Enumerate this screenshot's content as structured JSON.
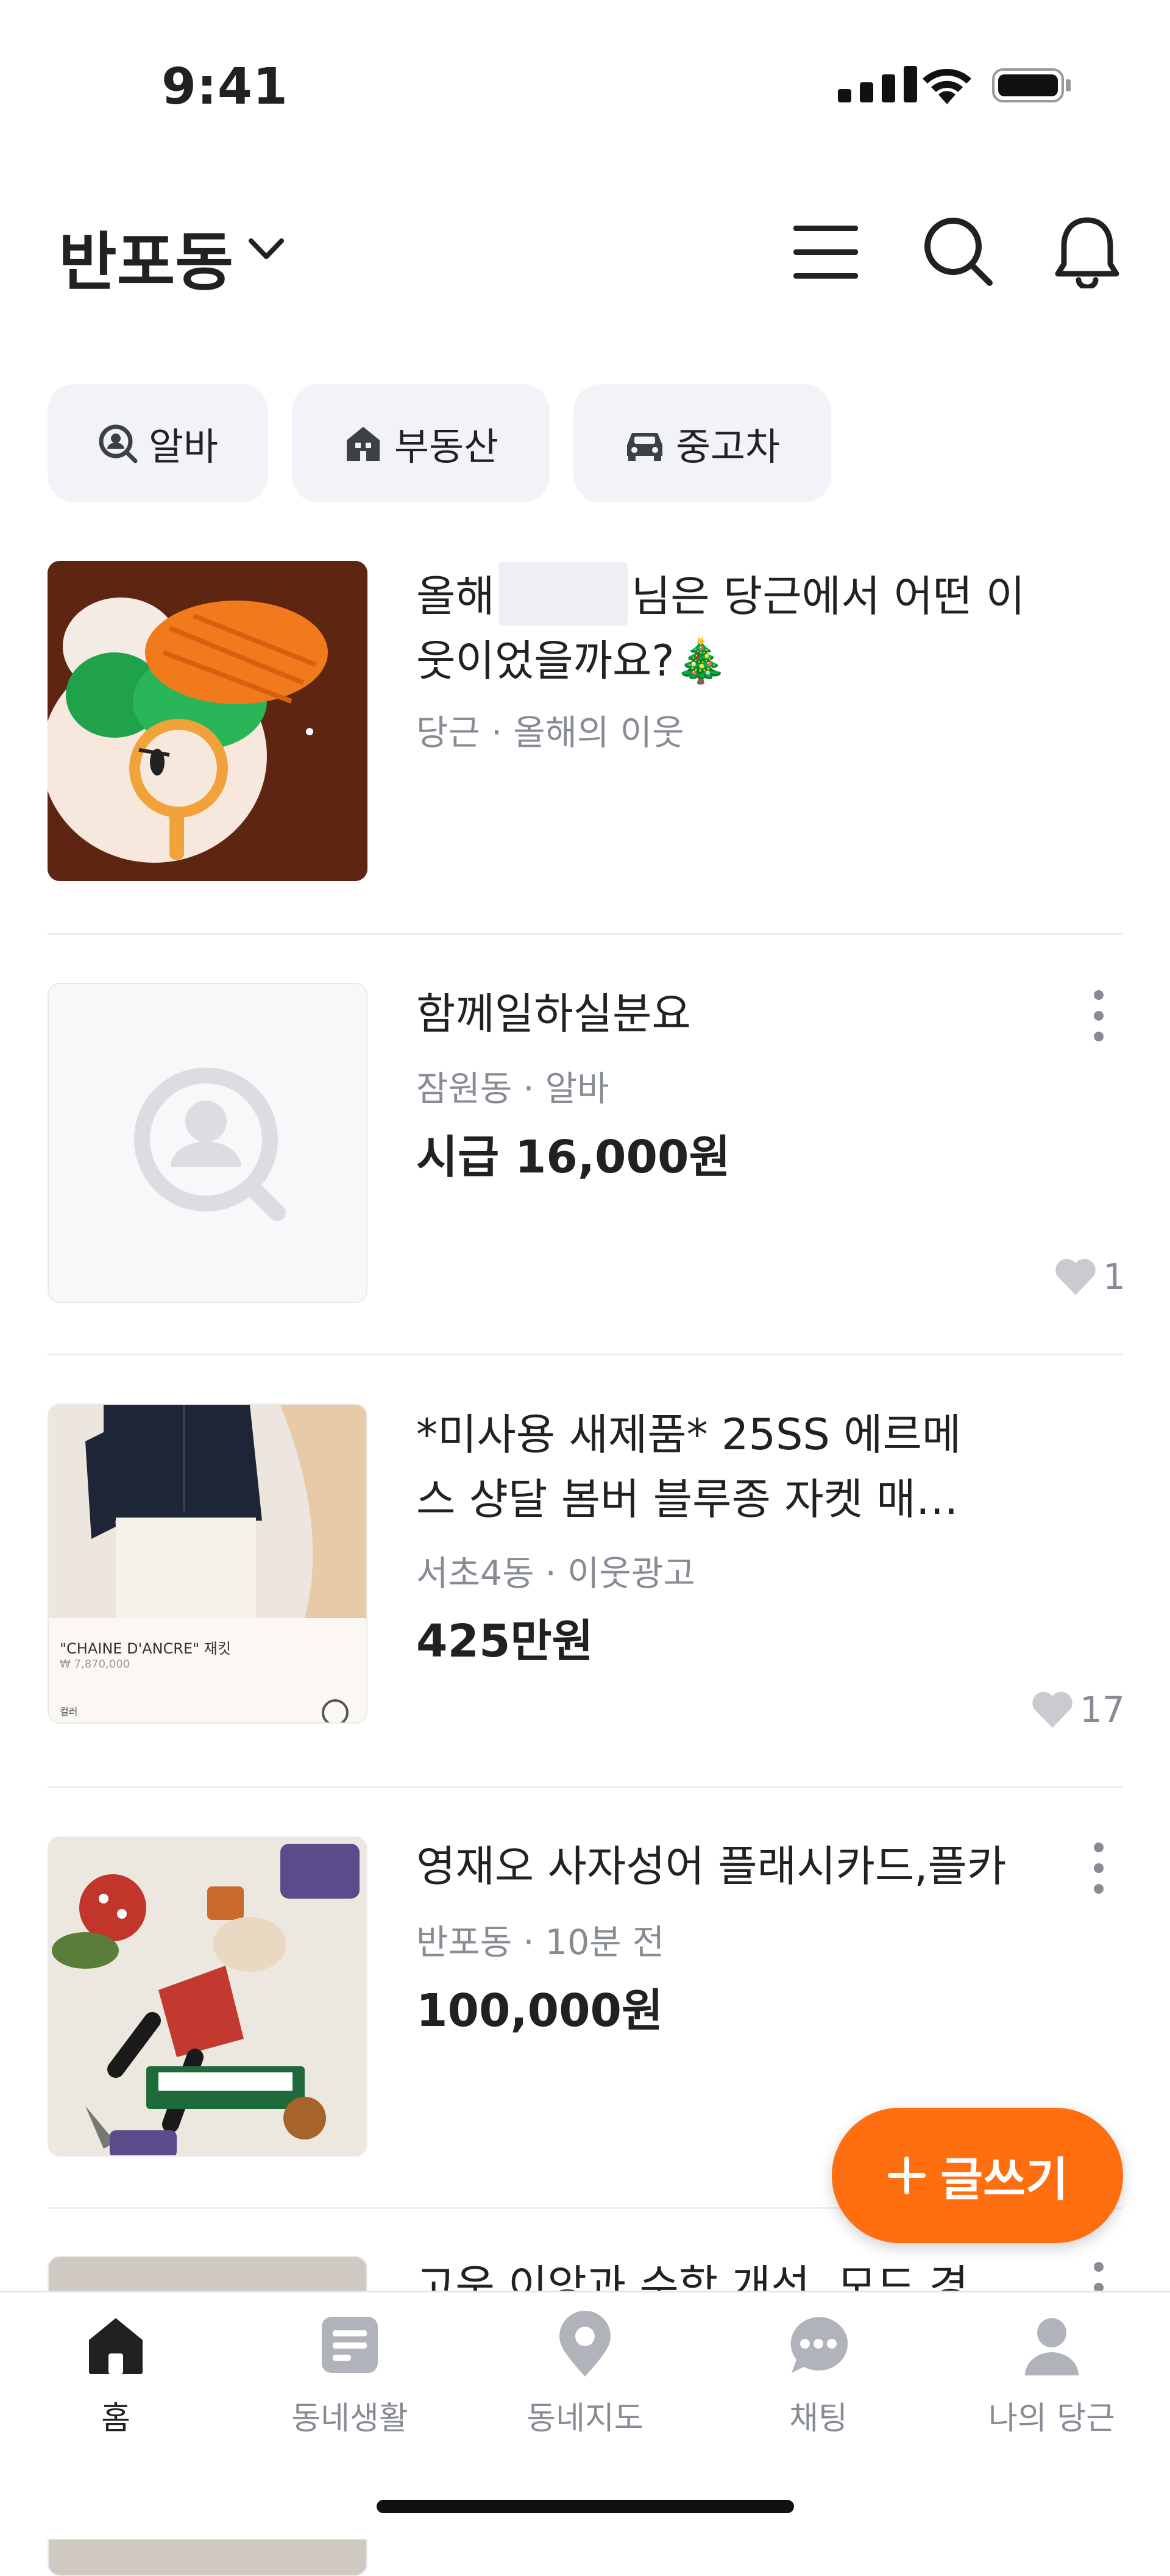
{
  "status_bar": {
    "time": "9:41"
  },
  "header": {
    "location": "반포동"
  },
  "chips": [
    {
      "label": "알바",
      "icon": "job-search-icon"
    },
    {
      "label": "부동산",
      "icon": "house-icon"
    },
    {
      "label": "중고차",
      "icon": "car-icon"
    }
  ],
  "feed": [
    {
      "title_line1a": "올해",
      "title_line1b": "님은 당근에서 어떤 이",
      "title_line2": "웃이었을까요?🎄",
      "meta": "당근 · 올해의 이웃"
    },
    {
      "title": "함께일하실분요",
      "meta": "잠원동 · 알바",
      "price": "시급 16,000원",
      "likes": "1"
    },
    {
      "title_line1": "*미사용 새제품* 25SS 에르메",
      "title_line2": "스 샹달 봄버 블루종 자켓 매…",
      "meta": "서초4동 · 이웃광고",
      "price": "425만원",
      "likes": "17",
      "thumb_caption": "\"CHAINE D'ANCRE\" 재킷",
      "thumb_price": "₩ 7,870,000",
      "thumb_tag": "컬러"
    },
    {
      "title": "영재오 사자성어 플래시카드,플카",
      "meta": "반포동 · 10분 전",
      "price": "100,000원"
    },
    {
      "title": "고운 이앙과 수학 개선, 모드 경"
    }
  ],
  "fab": {
    "label": "글쓰기"
  },
  "nav": [
    {
      "label": "홈",
      "active": true
    },
    {
      "label": "동네생활"
    },
    {
      "label": "동네지도"
    },
    {
      "label": "채팅"
    },
    {
      "label": "나의 당근"
    }
  ],
  "colors": {
    "brand": "#ff6f0f",
    "text": "#212124",
    "muted": "#868b94"
  }
}
